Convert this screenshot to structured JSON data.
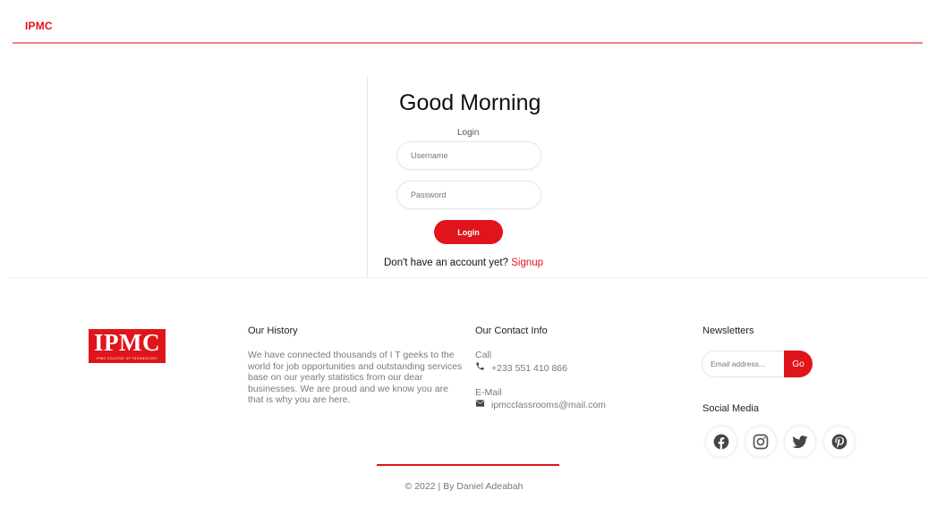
{
  "header": {
    "brand": "IPMC",
    "accent_color": "#e0151b"
  },
  "login": {
    "greeting": "Good Morning",
    "subtitle": "Login",
    "username_placeholder": "Username",
    "password_placeholder": "Password",
    "button_label": "Login",
    "signup_prompt": "Don't have an account yet? ",
    "signup_link": "Signup"
  },
  "footer": {
    "logo": {
      "text": "IPMC",
      "tagline": "IPMC COLLEGE OF TECHNOLOGY"
    },
    "history": {
      "title": "Our History",
      "text": "We have connected thousands of I T geeks to the world for job opportunities and outstanding services base on our yearly statistics from our dear businesses. We are proud and we know you are that is why you are here."
    },
    "contact": {
      "title": "Our Contact Info",
      "call_label": "Call",
      "phone": "+233 551 410 866",
      "email_label": "E-Mail",
      "email": "ipmcclassrooms@mail.com",
      "phone_icon": "phone-icon",
      "email_icon": "envelope-icon"
    },
    "newsletter": {
      "title": "Newsletters",
      "placeholder": "Email address...",
      "button_label": "Go"
    },
    "social": {
      "title": "Social Media",
      "icons": [
        "facebook-icon",
        "instagram-icon",
        "twitter-icon",
        "pinterest-icon"
      ]
    },
    "copyright": "© 2022 | By Daniel Adeabah"
  }
}
